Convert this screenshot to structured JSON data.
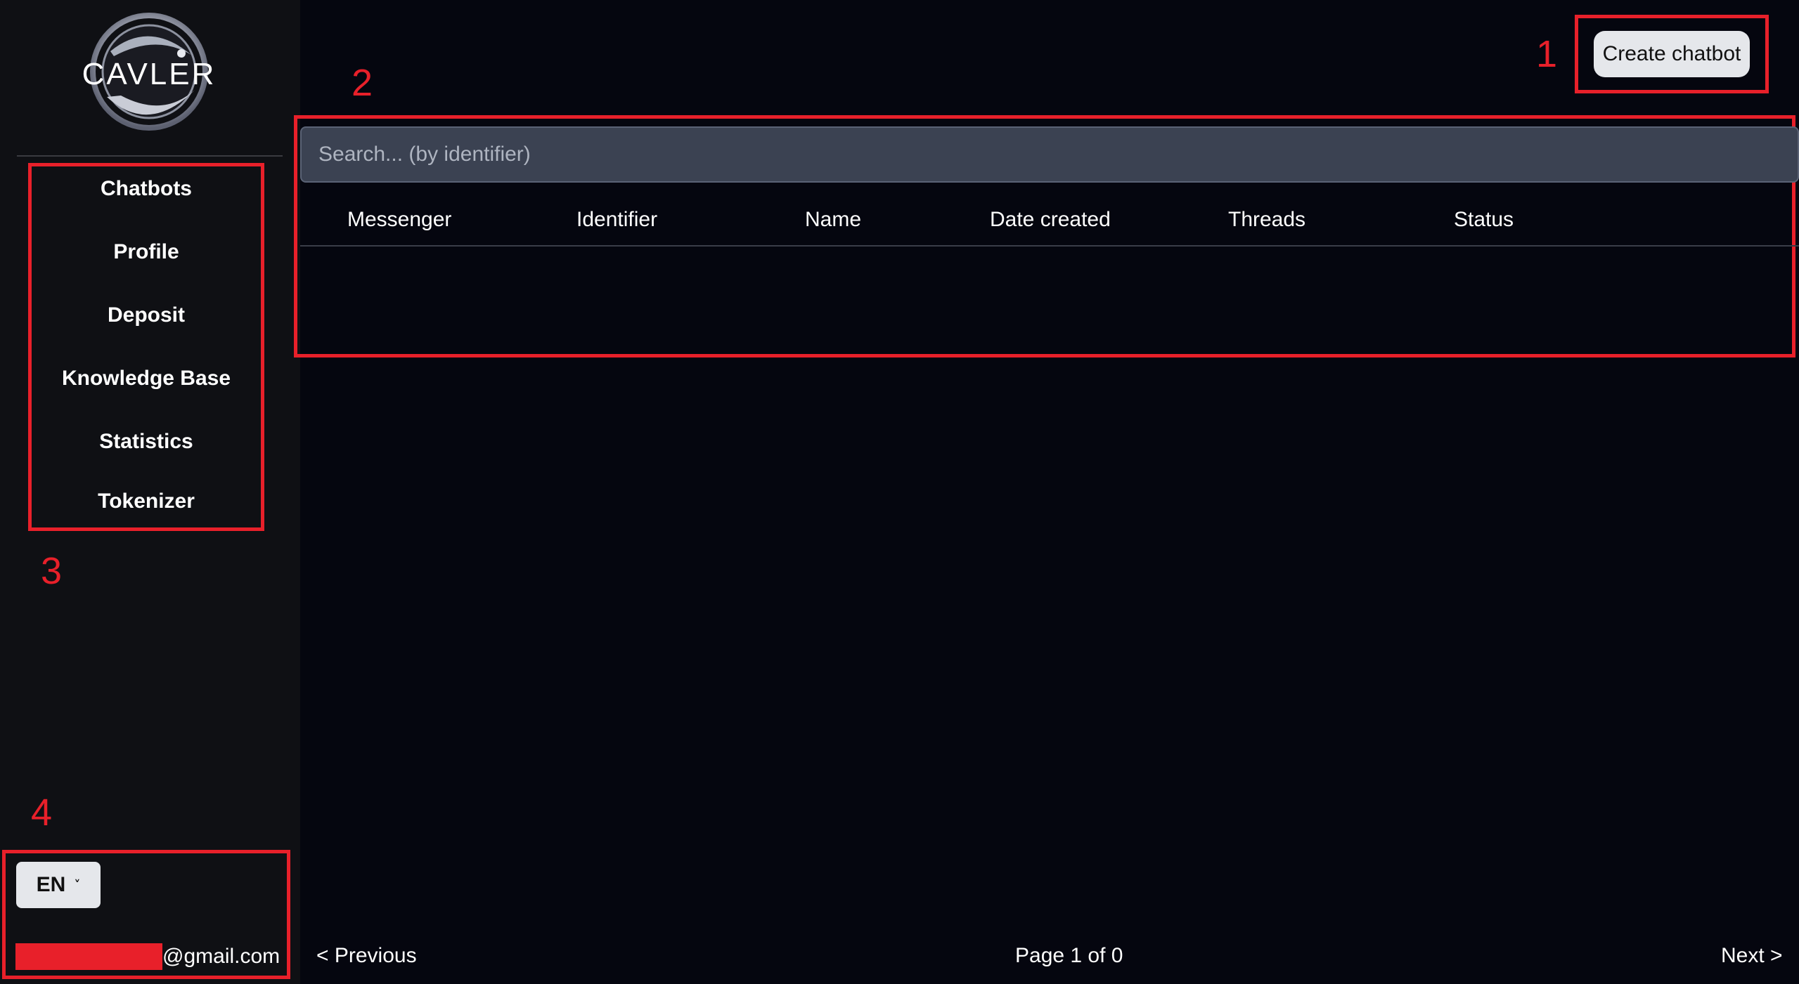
{
  "sidebar": {
    "logo_text": "CAVLER",
    "items": [
      {
        "label": "Chatbots"
      },
      {
        "label": "Profile"
      },
      {
        "label": "Deposit"
      },
      {
        "label": "Knowledge Base"
      },
      {
        "label": "Statistics"
      },
      {
        "label": "Tokenizer"
      }
    ],
    "language": "EN",
    "email_domain": "@gmail.com"
  },
  "header": {
    "create_label": "Create chatbot"
  },
  "search": {
    "placeholder": "Search... (by identifier)"
  },
  "table": {
    "columns": [
      "Messenger",
      "Identifier",
      "Name",
      "Date created",
      "Threads",
      "Status"
    ],
    "rows": []
  },
  "pagination": {
    "previous_label": "< Previous",
    "page_text": "Page 1 of 0",
    "next_label": "Next >"
  },
  "annotations": [
    "1",
    "2",
    "3",
    "4"
  ],
  "colors": {
    "background": "#05060f",
    "sidebar": "#0f1014",
    "annotation": "#e8202a",
    "button": "#e5e7eb",
    "search": "#3b4252"
  }
}
